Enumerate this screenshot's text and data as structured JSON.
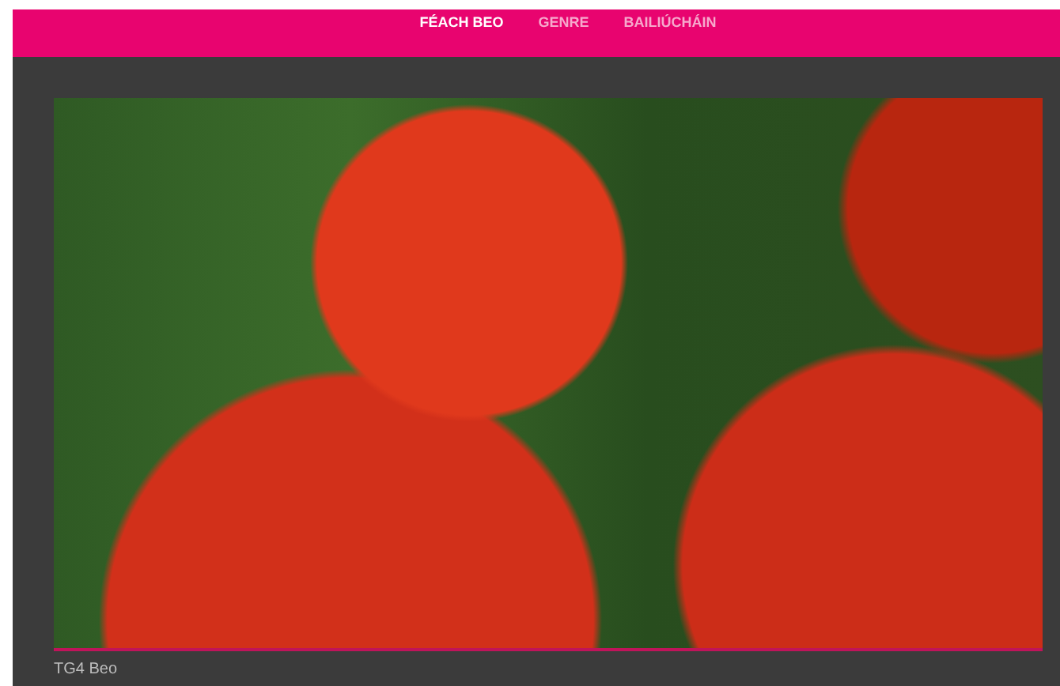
{
  "nav": [
    {
      "label": "FÉACH BEO",
      "selected": true
    },
    {
      "label": "GENRE",
      "selected": false
    },
    {
      "label": "BAILIÚCHÁIN",
      "selected": false
    }
  ],
  "player": {
    "caption": "TG4 Beo"
  }
}
